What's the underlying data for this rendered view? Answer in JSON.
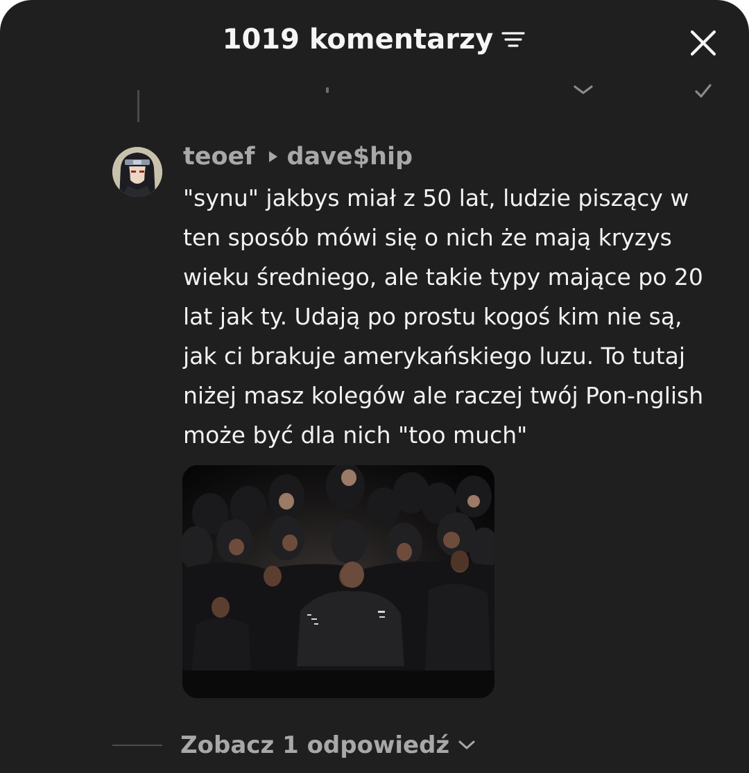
{
  "header": {
    "title": "1019 komentarzy",
    "sort_icon": "sort-lines-icon",
    "close_icon": "close-x-icon"
  },
  "comment": {
    "username": "teoef",
    "reply_to": "dave$hip",
    "reply_icon": "play-triangle-icon",
    "text_lines": [
      "\"synu\" jakbys miał z 50 lat, ludzie piszący w",
      "ten sposób mówi się o nich że mają kryzys",
      "wieku średniego, ale takie typy mające po 20",
      "lat jak ty. Udają po prostu kogoś kim nie są,",
      "jak ci brakuje amerykańskiego luzu. To tutaj",
      "niżej masz kolegów ale raczej twój Pon-nglish",
      "może być dla nich \"too much\""
    ]
  },
  "replies": {
    "label": "Zobacz 1 odpowiedź",
    "icon": "chevron-down-icon"
  },
  "colors": {
    "background": "#1f1f1f",
    "text_primary": "#f2f2f2",
    "text_secondary": "#a8a8a8"
  }
}
